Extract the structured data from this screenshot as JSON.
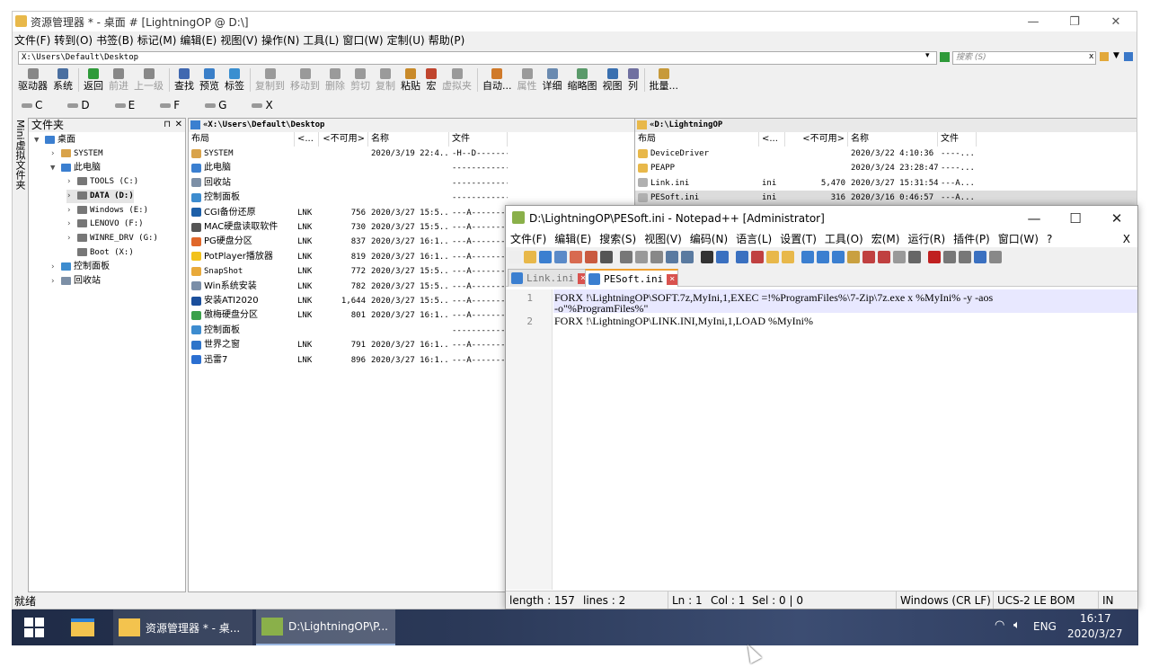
{
  "explorer": {
    "title": "资源管理器 * - 桌面 # [LightningOP @ D:\\]",
    "menu": [
      "文件(F)",
      "转到(O)",
      "书签(B)",
      "标记(M)",
      "编辑(E)",
      "视图(V)",
      "操作(N)",
      "工具(L)",
      "窗口(W)",
      "定制(U)",
      "帮助(P)"
    ],
    "address": "X:\\Users\\Default\\Desktop",
    "search_placeholder": "搜索 (S)",
    "toolbar": [
      {
        "label": "驱动器",
        "icon": "drive-icon",
        "enabled": true
      },
      {
        "label": "系统",
        "icon": "system-icon",
        "enabled": true
      },
      {
        "label": "返回",
        "icon": "back-icon",
        "enabled": true
      },
      {
        "label": "前进",
        "icon": "forward-icon",
        "enabled": false
      },
      {
        "label": "上一级",
        "icon": "up-icon",
        "enabled": false
      },
      {
        "label": "查找",
        "icon": "find-icon",
        "enabled": true
      },
      {
        "label": "预览",
        "icon": "preview-icon",
        "enabled": true
      },
      {
        "label": "标签",
        "icon": "tab-icon",
        "enabled": true
      },
      {
        "label": "复制到",
        "icon": "copy-to-icon",
        "enabled": false
      },
      {
        "label": "移动到",
        "icon": "move-to-icon",
        "enabled": false
      },
      {
        "label": "删除",
        "icon": "delete-icon",
        "enabled": false
      },
      {
        "label": "剪切",
        "icon": "cut-icon",
        "enabled": false
      },
      {
        "label": "复制",
        "icon": "copy-icon",
        "enabled": false
      },
      {
        "label": "粘贴",
        "icon": "paste-icon",
        "enabled": true
      },
      {
        "label": "宏",
        "icon": "macro-icon",
        "enabled": true
      },
      {
        "label": "虚拟夹",
        "icon": "virtual-folder-icon",
        "enabled": false
      },
      {
        "label": "自动...",
        "icon": "auto-icon",
        "enabled": true
      },
      {
        "label": "属性",
        "icon": "properties-icon",
        "enabled": false
      },
      {
        "label": "详细",
        "icon": "details-icon",
        "enabled": true
      },
      {
        "label": "缩略图",
        "icon": "thumbnail-icon",
        "enabled": true
      },
      {
        "label": "视图",
        "icon": "view-icon",
        "enabled": true
      },
      {
        "label": "列",
        "icon": "columns-icon",
        "enabled": true
      },
      {
        "label": "批量...",
        "icon": "batch-icon",
        "enabled": true
      }
    ],
    "drives": [
      "C",
      "D",
      "E",
      "F",
      "G",
      "X"
    ],
    "minibar": "Mini虚拟文件夹",
    "tree_header": "文件夹",
    "tree": [
      {
        "label": "桌面",
        "level": 0,
        "arrow": "▼"
      },
      {
        "label": "SYSTEM",
        "level": 1,
        "arrow": "›"
      },
      {
        "label": "此电脑",
        "level": 1,
        "arrow": "▼"
      },
      {
        "label": "TOOLS (C:)",
        "level": 2,
        "arrow": "›"
      },
      {
        "label": "DATA (D:)",
        "level": 2,
        "arrow": "›"
      },
      {
        "label": "Windows (E:)",
        "level": 2,
        "arrow": "›"
      },
      {
        "label": "LENOVO (F:)",
        "level": 2,
        "arrow": "›"
      },
      {
        "label": "WINRE_DRV (G:)",
        "level": 2,
        "arrow": "›"
      },
      {
        "label": "Boot (X:)",
        "level": 2,
        "arrow": ""
      },
      {
        "label": "控制面板",
        "level": 1,
        "arrow": "›"
      },
      {
        "label": "回收站",
        "level": 1,
        "arrow": "›"
      }
    ],
    "pane1": {
      "path": "«X:\\Users\\Default\\Desktop",
      "columns": [
        "布局",
        "<...",
        "<不可用>",
        "名称",
        "文件"
      ],
      "rows": [
        {
          "name": "SYSTEM",
          "ext": "",
          "size": "",
          "date": "2020/3/19 22:4...",
          "attr": "-H--D-------",
          "color": "#d9a34a"
        },
        {
          "name": "此电脑",
          "ext": "",
          "size": "",
          "date": "",
          "attr": "------------",
          "color": "#3b7fd0"
        },
        {
          "name": "回收站",
          "ext": "",
          "size": "",
          "date": "",
          "attr": "------------",
          "color": "#7c8fa6"
        },
        {
          "name": "控制面板",
          "ext": "",
          "size": "",
          "date": "",
          "attr": "------------",
          "color": "#3d8ccf"
        },
        {
          "name": "CGI备份还原",
          "ext": "LNK",
          "size": "756",
          "date": "2020/3/27 15:5...",
          "attr": "---A--------",
          "color": "#1d5fa8"
        },
        {
          "name": "MAC硬盘读取软件",
          "ext": "LNK",
          "size": "730",
          "date": "2020/3/27 15:5...",
          "attr": "---A--------",
          "color": "#555555"
        },
        {
          "name": "PG硬盘分区",
          "ext": "LNK",
          "size": "837",
          "date": "2020/3/27 16:1...",
          "attr": "---A--------",
          "color": "#e0672a"
        },
        {
          "name": "PotPlayer播放器",
          "ext": "LNK",
          "size": "819",
          "date": "2020/3/27 16:1...",
          "attr": "---A--------",
          "color": "#f2c21b"
        },
        {
          "name": "SnapShot",
          "ext": "LNK",
          "size": "772",
          "date": "2020/3/27 15:5...",
          "attr": "---A--------",
          "color": "#e8a93a"
        },
        {
          "name": "Win系统安装",
          "ext": "LNK",
          "size": "782",
          "date": "2020/3/27 15:5...",
          "attr": "---A--------",
          "color": "#7a8ea8"
        },
        {
          "name": "安装ATI2020",
          "ext": "LNK",
          "size": "1,644",
          "date": "2020/3/27 15:5...",
          "attr": "---A--------",
          "color": "#1b4f9c"
        },
        {
          "name": "傲梅硬盘分区",
          "ext": "LNK",
          "size": "801",
          "date": "2020/3/27 16:1...",
          "attr": "---A--------",
          "color": "#3aa04a"
        },
        {
          "name": "控制面板",
          "ext": "",
          "size": "",
          "date": "",
          "attr": "------------",
          "color": "#3d8ccf"
        },
        {
          "name": "世界之窗",
          "ext": "LNK",
          "size": "791",
          "date": "2020/3/27 16:1...",
          "attr": "---A--------",
          "color": "#2e74c9"
        },
        {
          "name": "迅雷7",
          "ext": "LNK",
          "size": "896",
          "date": "2020/3/27 16:1...",
          "attr": "---A--------",
          "color": "#2b6fd1"
        }
      ]
    },
    "pane2": {
      "path": "«D:\\LightningOP",
      "columns": [
        "布局",
        "<...",
        "<不可用>",
        "名称",
        "文件"
      ],
      "rows": [
        {
          "name": "DeviceDriver",
          "ext": "",
          "size": "",
          "date": "2020/3/22 4:10:36",
          "attr": "----...",
          "color": "#e8b84a"
        },
        {
          "name": "PEAPP",
          "ext": "",
          "size": "",
          "date": "2020/3/24 23:28:47",
          "attr": "----...",
          "color": "#e8b84a"
        },
        {
          "name": "Link.ini",
          "ext": "ini",
          "size": "5,470",
          "date": "2020/3/27 15:31:54",
          "attr": "---A...",
          "color": "#b0b0b0"
        },
        {
          "name": "PESoft.ini",
          "ext": "ini",
          "size": "316",
          "date": "2020/3/16 0:46:57",
          "attr": "---A...",
          "color": "#b0b0b0"
        }
      ]
    },
    "status": "就绪"
  },
  "notepad": {
    "title": "D:\\LightningOP\\PESoft.ini - Notepad++ [Administrator]",
    "menu": [
      "文件(F)",
      "编辑(E)",
      "搜索(S)",
      "视图(V)",
      "编码(N)",
      "语言(L)",
      "设置(T)",
      "工具(O)",
      "宏(M)",
      "运行(R)",
      "插件(P)",
      "窗口(W)",
      "?"
    ],
    "menu_close": "X",
    "tabs": [
      {
        "label": "Link.ini",
        "active": false
      },
      {
        "label": "PESoft.ini",
        "active": true
      }
    ],
    "lines": [
      {
        "num": "1",
        "text": "FORX !\\LightningOP\\SOFT.7z,MyIni,1,EXEC =!%ProgramFiles%\\7-Zip\\7z.exe x %MyIni% -y -aos",
        "wrap": "-o\"%ProgramFiles%\""
      },
      {
        "num": "2",
        "text": "FORX !\\LightningOP\\LINK.INI,MyIni,1,LOAD %MyIni%",
        "wrap": ""
      }
    ],
    "status": {
      "length": "length : 157",
      "lines": "lines : 2",
      "ln": "Ln : 1",
      "col": "Col : 1",
      "sel": "Sel : 0 | 0",
      "eol": "Windows (CR LF)",
      "encoding": "UCS-2 LE BOM",
      "ins": "IN"
    }
  },
  "taskbar": {
    "items": [
      {
        "label": "资源管理器 * - 桌...",
        "active": false
      },
      {
        "label": "D:\\LightningOP\\P...",
        "active": true
      }
    ],
    "lang": "ENG",
    "time": "16:17",
    "date": "2020/3/27"
  },
  "colors": {
    "accent": "#3b7fd0",
    "taskbar": "#2b3958",
    "highlight_line": "#e8e8ff"
  }
}
